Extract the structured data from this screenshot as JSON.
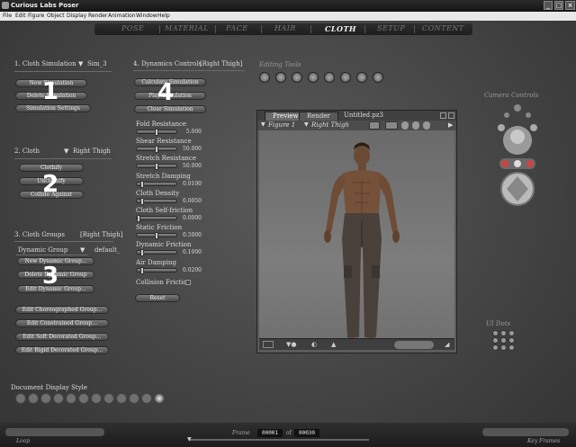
{
  "window": {
    "title": "Curious Labs Poser"
  },
  "menu": [
    "File",
    "Edit",
    "Figure",
    "Object",
    "Display",
    "Render",
    "Animation",
    "Window",
    "Help"
  ],
  "tabs": [
    {
      "label": "POSE",
      "active": false
    },
    {
      "label": "MATERIAL",
      "active": false
    },
    {
      "label": "FACE",
      "active": false
    },
    {
      "label": "HAIR",
      "active": false
    },
    {
      "label": "CLOTH",
      "active": true
    },
    {
      "label": "SETUP",
      "active": false
    },
    {
      "label": "CONTENT",
      "active": false
    }
  ],
  "cloth_simulation": {
    "heading": "1. Cloth Simulation",
    "selected": "Sim_3",
    "buttons": [
      "New Simulation",
      "Delete Simulation",
      "Simulation Settings"
    ],
    "callout": "1"
  },
  "cloth": {
    "heading": "2. Cloth",
    "selected": "Right Thigh",
    "buttons": [
      "Clothify",
      "Unclothify",
      "Collide Against"
    ],
    "callout": "2"
  },
  "cloth_groups": {
    "heading": "3. Cloth Groups",
    "target": "[Right Thigh]",
    "dropdown": "Dynamic Group",
    "dropdown_value": "default_",
    "buttons": [
      "New Dynamic Group...",
      "Delete Dynamic Group",
      "Edit Dynamic Group..."
    ],
    "more_buttons": [
      "Edit Choreographed Group...",
      "Edit Constrained Group...",
      "Edit Soft Decorated Group...",
      "Edit Rigid Decorated Group..."
    ],
    "callout": "3"
  },
  "dynamics": {
    "heading": "4. Dynamics Controls",
    "target": "[Right Thigh]",
    "buttons": [
      "Calculate Simulation",
      "Play Simulation",
      "Clear Simulation"
    ],
    "callout": "4",
    "params": [
      {
        "label": "Fold Resistance",
        "value": "5.000",
        "level": 0.5
      },
      {
        "label": "Shear Resistance",
        "value": "50.000",
        "level": 0.5
      },
      {
        "label": "Stretch Resistance",
        "value": "50.000",
        "level": 0.5
      },
      {
        "label": "Stretch Damping",
        "value": "0.0100",
        "level": 0.1
      },
      {
        "label": "Cloth Density",
        "value": "0.0050",
        "level": 0.1
      },
      {
        "label": "Cloth Self-friction",
        "value": "0.0000",
        "level": 0.0
      },
      {
        "label": "Static Friction",
        "value": "0.5000",
        "level": 0.5
      },
      {
        "label": "Dynamic Friction",
        "value": "0.1000",
        "level": 0.1
      },
      {
        "label": "Air Damping",
        "value": "0.0200",
        "level": 0.1
      }
    ],
    "collision_friction": "Collision Friction",
    "reset": "Reset"
  },
  "editing_tools": {
    "label": "Editing Tools"
  },
  "preview": {
    "tabs": [
      "Preview",
      "Render"
    ],
    "doc_title": "Untitled.pz3",
    "figure": "Figure 1",
    "part": "Right Thigh"
  },
  "camera_controls": {
    "label": "Camera Controls"
  },
  "ui_dots": {
    "label": "UI Dots"
  },
  "document_display": {
    "label": "Document Display Style"
  },
  "timeline": {
    "frame_label": "Frame",
    "frame": "00001",
    "total": "00030",
    "left_text": "Loop",
    "right_text": "Key Frames"
  },
  "colors": {
    "accent": "#f4f4f4",
    "panel": "#4a4a4a"
  }
}
